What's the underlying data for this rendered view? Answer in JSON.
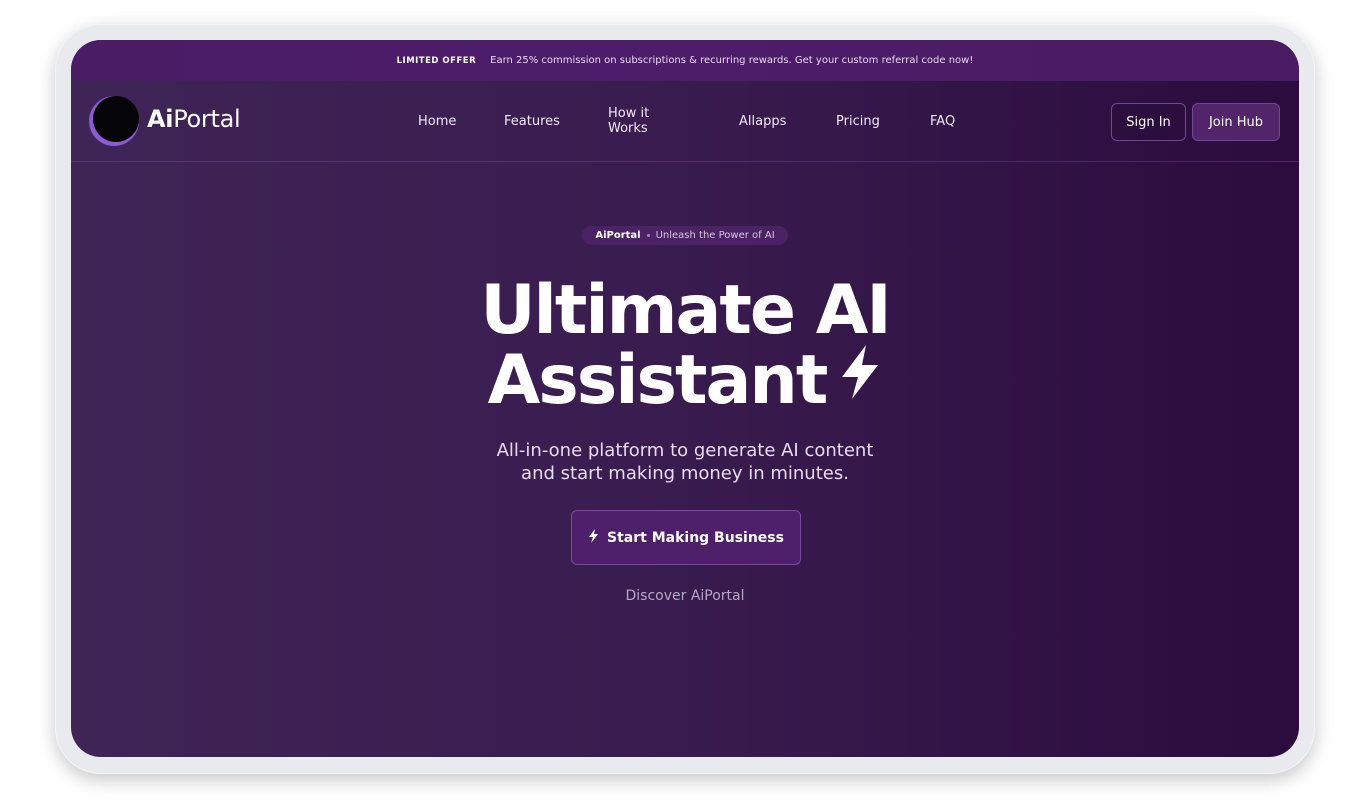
{
  "promo": {
    "tag": "LIMITED OFFER",
    "text": "Earn 25% commission on subscriptions & recurring rewards. Get your custom referral code now!"
  },
  "brand": {
    "logo_bold": "Ai",
    "logo_rest": "Portal"
  },
  "nav": {
    "items": [
      {
        "label": "Home"
      },
      {
        "label": "Features"
      },
      {
        "label": "How it Works"
      },
      {
        "label": "Allapps"
      },
      {
        "label": "Pricing"
      },
      {
        "label": "FAQ"
      }
    ],
    "signin_label": "Sign In",
    "join_label": "Join Hub"
  },
  "hero": {
    "pill_brand": "AiPortal",
    "pill_text": "Unleash the Power of AI",
    "title_line1": "Ultimate AI",
    "title_line2": "Assistant",
    "subtitle_line1": "All-in-one platform to generate AI content",
    "subtitle_line2": "and start making money in minutes.",
    "cta_label": "Start Making Business",
    "discover_label": "Discover AiPortal"
  },
  "icons": {
    "hero_bolt": "lightning-bolt-icon",
    "cta_bolt": "lightning-bolt-icon"
  },
  "colors": {
    "background": "#3a1d50",
    "promo_bar": "#4d1d6a",
    "accent": "#8d5ad6",
    "button": "#52246c"
  }
}
